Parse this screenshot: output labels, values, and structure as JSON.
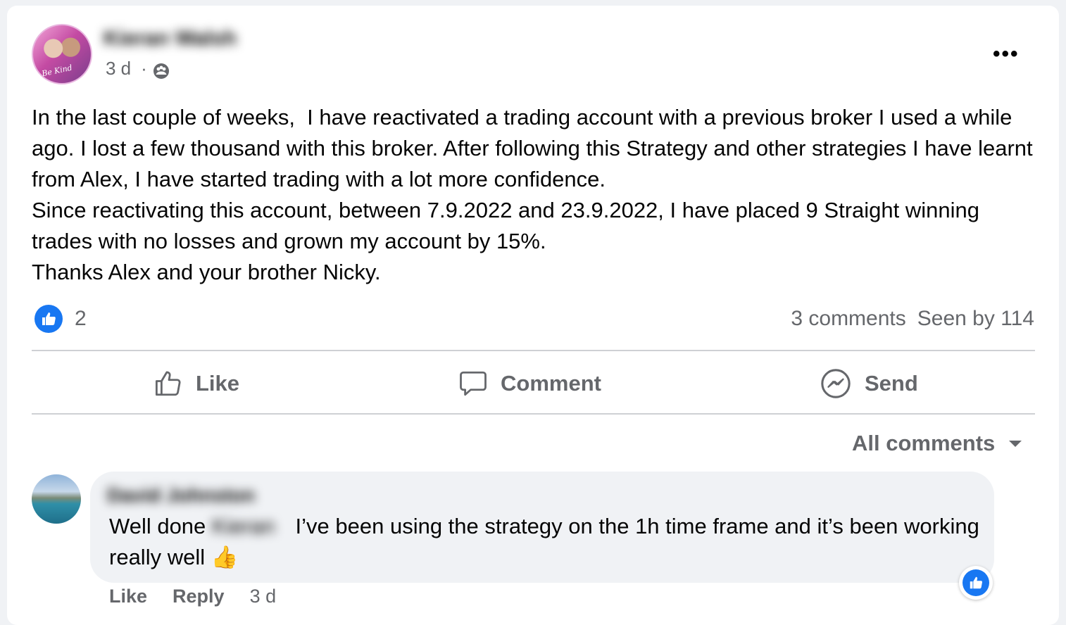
{
  "post": {
    "author_name": "Kieran Walsh",
    "avatar_text": "Be Kind",
    "time": "3 d",
    "separator": "·",
    "privacy_icon": "group-icon",
    "more_label": "•••",
    "paragraphs": [
      "In the last couple of weeks,  I have reactivated a trading account with a previous broker I used a while ago. I lost a few thousand with this broker. After following this Strategy and other strategies I have learnt from Alex, I have started trading with a lot more confidence.",
      "Since reactivating this account, between 7.9.2022 and 23.9.2022, I have placed 9 Straight winning trades with no losses and grown my account by 15%.",
      "Thanks Alex and your brother Nicky."
    ],
    "reactions_count": "2",
    "comments_count": "3 comments",
    "seen_by": "Seen by 114"
  },
  "actions": {
    "like": "Like",
    "comment": "Comment",
    "send": "Send"
  },
  "filter": {
    "label": "All comments"
  },
  "comment": {
    "author_name": "David Johnston",
    "text_before": "Well done ",
    "mention": "Kieran",
    "text_after": " I’ve been using the strategy on the 1h time frame and it’s been working really well ",
    "emoji": "👍",
    "like": "Like",
    "reply": "Reply",
    "time": "3 d"
  },
  "colors": {
    "accent": "#1877f2",
    "secondary_text": "#65676b",
    "bubble": "#f0f2f5"
  }
}
